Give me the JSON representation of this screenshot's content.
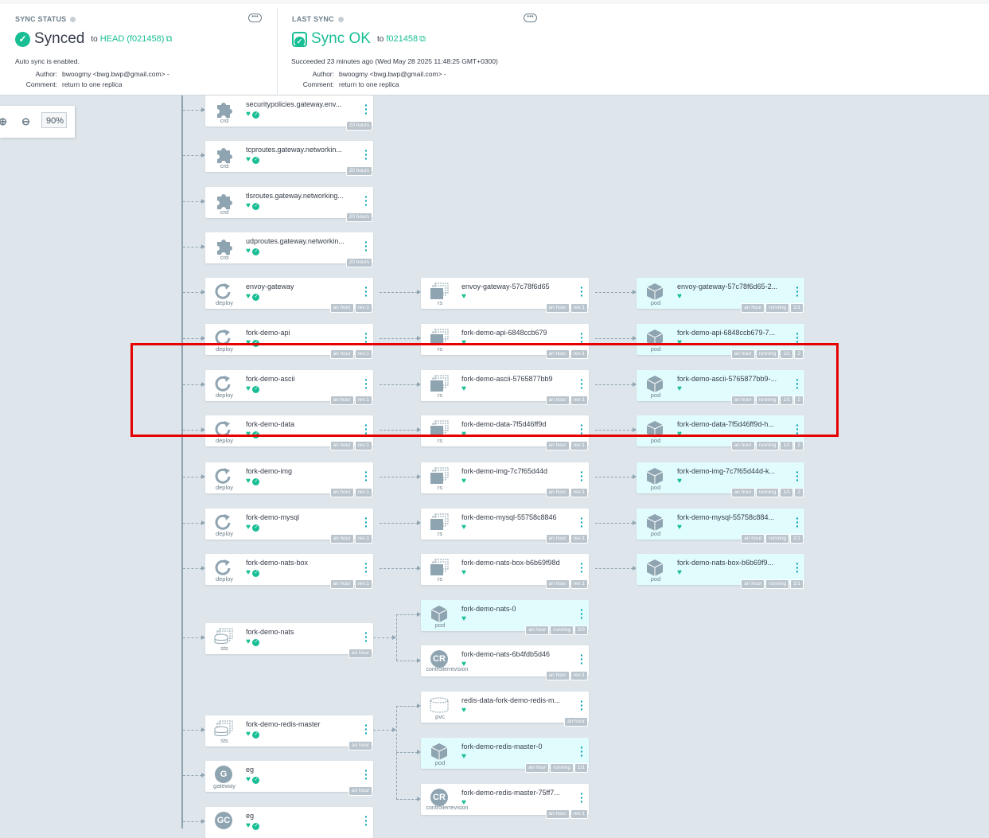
{
  "sync_status": {
    "title": "SYNC STATUS",
    "status": "Synced",
    "to": "to",
    "revision": "HEAD (f021458)",
    "auto_sync": "Auto sync is enabled.",
    "author_label": "Author:",
    "author": "bwoogmy <bwg.bwp@gmail.com> -",
    "comment_label": "Comment:",
    "comment": "return to one replica"
  },
  "last_sync": {
    "title": "LAST SYNC",
    "status": "Sync OK",
    "to": "to",
    "revision": "f021458",
    "succeeded": "Succeeded 23 minutes ago (Wed May 28 2025 11:48:25 GMT+0300)",
    "author_label": "Author:",
    "author": "bwoogmy <bwg.bwp@gmail.com> -",
    "comment_label": "Comment:",
    "comment": "return to one replica"
  },
  "zoom": {
    "value": "90%"
  },
  "colors": {
    "healthy": "#18be94",
    "highlight": "#e60000",
    "pod_bg": "#e1fcfd"
  },
  "nodes": {
    "crd1": {
      "name": "securitypolicies.gateway.env...",
      "kind": "crd",
      "tags": [
        "20 hours"
      ]
    },
    "crd2": {
      "name": "tcproutes.gateway.networkin...",
      "kind": "crd",
      "tags": [
        "20 hours"
      ]
    },
    "crd3": {
      "name": "tlsroutes.gateway.networking...",
      "kind": "crd",
      "tags": [
        "20 hours"
      ]
    },
    "crd4": {
      "name": "udproutes.gateway.networkin...",
      "kind": "crd",
      "tags": [
        "20 hours"
      ]
    },
    "d_envoy": {
      "name": "envoy-gateway",
      "kind": "deploy",
      "tags": [
        "an hour",
        "rev:1"
      ]
    },
    "r_envoy": {
      "name": "envoy-gateway-57c78f6d65",
      "kind": "rs",
      "tags": [
        "an hour",
        "rev:1"
      ]
    },
    "p_envoy": {
      "name": "envoy-gateway-57c78f6d65-2...",
      "kind": "pod",
      "tags": [
        "an hour",
        "running",
        "1/1"
      ]
    },
    "d_api": {
      "name": "fork-demo-api",
      "kind": "deploy",
      "tags": [
        "an hour",
        "rev:1"
      ]
    },
    "r_api": {
      "name": "fork-demo-api-6848ccb679",
      "kind": "rs",
      "tags": [
        "an hour",
        "rev:1"
      ]
    },
    "p_api": {
      "name": "fork-demo-api-6848ccb679-7...",
      "kind": "pod",
      "tags": [
        "an hour",
        "running",
        "1/1",
        "2"
      ]
    },
    "d_ascii": {
      "name": "fork-demo-ascii",
      "kind": "deploy",
      "tags": [
        "an hour",
        "rev:1"
      ]
    },
    "r_ascii": {
      "name": "fork-demo-ascii-5765877bb9",
      "kind": "rs",
      "tags": [
        "an hour",
        "rev:1"
      ]
    },
    "p_ascii": {
      "name": "fork-demo-ascii-5765877bb9-...",
      "kind": "pod",
      "tags": [
        "an hour",
        "running",
        "1/1",
        "2"
      ]
    },
    "d_data": {
      "name": "fork-demo-data",
      "kind": "deploy",
      "tags": [
        "an hour",
        "rev:1"
      ]
    },
    "r_data": {
      "name": "fork-demo-data-7f5d46ff9d",
      "kind": "rs",
      "tags": [
        "an hour",
        "rev:1"
      ]
    },
    "p_data": {
      "name": "fork-demo-data-7f5d46ff9d-h...",
      "kind": "pod",
      "tags": [
        "an hour",
        "running",
        "1/1",
        "2"
      ]
    },
    "d_img": {
      "name": "fork-demo-img",
      "kind": "deploy",
      "tags": [
        "an hour",
        "rev:1"
      ]
    },
    "r_img": {
      "name": "fork-demo-img-7c7f65d44d",
      "kind": "rs",
      "tags": [
        "an hour",
        "rev:1"
      ]
    },
    "p_img": {
      "name": "fork-demo-img-7c7f65d44d-k...",
      "kind": "pod",
      "tags": [
        "an hour",
        "running",
        "1/1",
        "2"
      ]
    },
    "d_mysql": {
      "name": "fork-demo-mysql",
      "kind": "deploy",
      "tags": [
        "an hour",
        "rev:1"
      ]
    },
    "r_mysql": {
      "name": "fork-demo-mysql-55758c8846",
      "kind": "rs",
      "tags": [
        "an hour",
        "rev:1"
      ]
    },
    "p_mysql": {
      "name": "fork-demo-mysql-55758c884...",
      "kind": "pod",
      "tags": [
        "an hour",
        "running",
        "1/1"
      ]
    },
    "d_nats": {
      "name": "fork-demo-nats-box",
      "kind": "deploy",
      "tags": [
        "an hour",
        "rev:1"
      ]
    },
    "r_nats": {
      "name": "fork-demo-nats-box-b6b69f98d",
      "kind": "rs",
      "tags": [
        "an hour",
        "rev:1"
      ]
    },
    "p_nats": {
      "name": "fork-demo-nats-box-b6b69f9...",
      "kind": "pod",
      "tags": [
        "an hour",
        "running",
        "1/1"
      ]
    },
    "s_nats": {
      "name": "fork-demo-nats",
      "kind": "sts",
      "tags": [
        "an hour"
      ]
    },
    "p_nats0": {
      "name": "fork-demo-nats-0",
      "kind": "pod",
      "tags": [
        "an hour",
        "running",
        "3/3"
      ]
    },
    "cr_nats": {
      "name": "fork-demo-nats-6b4fdb5d46",
      "kind": "controllerrevision",
      "tags": [
        "an hour",
        "rev:1"
      ]
    },
    "pvc_redis": {
      "name": "redis-data-fork-demo-redis-m...",
      "kind": "pvc",
      "tags": [
        "an hour"
      ]
    },
    "s_redis": {
      "name": "fork-demo-redis-master",
      "kind": "sts",
      "tags": [
        "an hour"
      ]
    },
    "p_redis0": {
      "name": "fork-demo-redis-master-0",
      "kind": "pod",
      "tags": [
        "an hour",
        "running",
        "1/1"
      ]
    },
    "eg": {
      "name": "eg",
      "kind": "gateway",
      "tags": [
        "an hour"
      ]
    },
    "cr_redis": {
      "name": "fork-demo-redis-master-75ff7...",
      "kind": "controllerrevision",
      "tags": [
        "an hour",
        "rev:1"
      ]
    },
    "egc": {
      "name": "eg",
      "kind": ""
    }
  }
}
